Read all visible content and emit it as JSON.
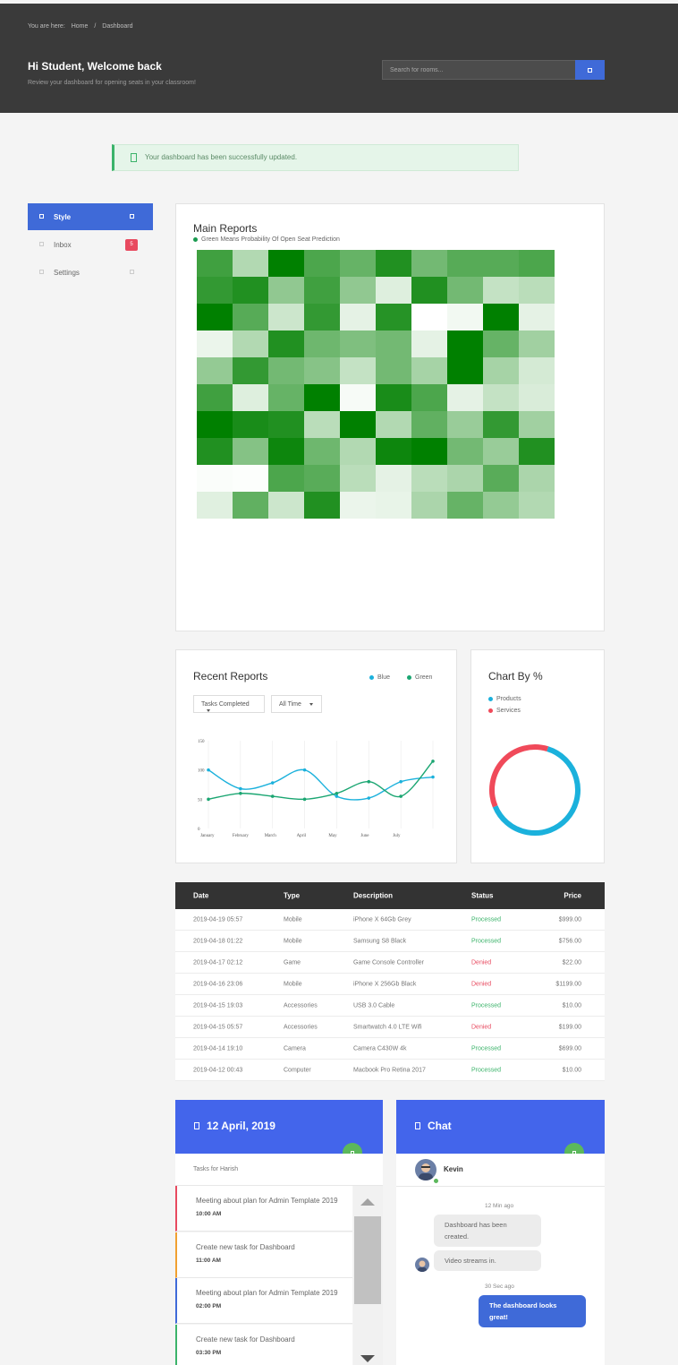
{
  "breadcrumb": {
    "prefix": "You are here:",
    "home": "Home",
    "sep": "/",
    "current": "Dashboard"
  },
  "header": {
    "welcome": "Hi Student, Welcome back",
    "subtitle": "Review your dashboard for opening seats in your classroom!"
  },
  "search": {
    "placeholder": "Search for rooms..."
  },
  "alert": {
    "text": "Your dashboard has been successfully updated."
  },
  "sidebar": {
    "items": [
      {
        "label": "Style",
        "active": true
      },
      {
        "label": "Inbox",
        "badge": "5"
      },
      {
        "label": "Settings"
      }
    ]
  },
  "main_reports": {
    "title": "Main Reports",
    "legend": "Green Means Probability Of Open Seat Prediction",
    "legend_color": "#008000",
    "heatmap_opacity": [
      [
        0.75,
        0.3,
        1,
        0.7,
        0.6,
        0.87,
        0.55,
        0.66,
        0.66,
        0.7
      ],
      [
        0.8,
        0.87,
        0.43,
        0.75,
        0.43,
        0.13,
        0.87,
        0.55,
        0.23,
        0.27
      ],
      [
        1,
        0.66,
        0.2,
        0.8,
        0.1,
        0.85,
        0,
        0.05,
        1,
        0.1
      ],
      [
        0.08,
        0.3,
        0.87,
        0.57,
        0.5,
        0.55,
        0.1,
        1,
        0.6,
        0.37
      ],
      [
        0.42,
        0.8,
        0.55,
        0.47,
        0.23,
        0.55,
        0.35,
        1,
        0.35,
        0.17
      ],
      [
        0.75,
        0.13,
        0.6,
        1,
        0.03,
        0.9,
        0.7,
        0.1,
        0.23,
        0.15
      ],
      [
        1,
        0.9,
        0.87,
        0.27,
        1,
        0.3,
        0.62,
        0.4,
        0.8,
        0.37
      ],
      [
        0.87,
        0.48,
        0.95,
        0.57,
        0.3,
        0.95,
        1,
        0.55,
        0.4,
        0.87
      ],
      [
        0.02,
        0.01,
        0.7,
        0.65,
        0.27,
        0.1,
        0.27,
        0.33,
        0.65,
        0.33
      ],
      [
        0.12,
        0.62,
        0.2,
        0.87,
        0.08,
        0.09,
        0.33,
        0.6,
        0.42,
        0.3
      ]
    ]
  },
  "recent_reports": {
    "title": "Recent Reports",
    "legend": [
      {
        "name": "Blue",
        "color": "#1bb1dc"
      },
      {
        "name": "Green",
        "color": "#1ba672"
      }
    ],
    "filter1": "Tasks Completed",
    "filter2": "All Time"
  },
  "chart_data": [
    {
      "type": "line",
      "title": "Recent Reports",
      "categories": [
        "January",
        "February",
        "March",
        "April",
        "May",
        "June",
        "July",
        ""
      ],
      "y_ticks": [
        "150",
        "100",
        "50",
        "0"
      ],
      "ylim": [
        0,
        150
      ],
      "series": [
        {
          "name": "Blue",
          "color": "#1bb1dc",
          "values": [
            100,
            68,
            78,
            100,
            55,
            52,
            80,
            88
          ]
        },
        {
          "name": "Green",
          "color": "#1ba672",
          "values": [
            50,
            60,
            55,
            50,
            60,
            80,
            55,
            115
          ]
        }
      ]
    },
    {
      "type": "pie",
      "title": "Chart By %",
      "categories": [
        "Products",
        "Services"
      ],
      "values": [
        64,
        36
      ],
      "colors": [
        "#1bb1dc",
        "#f04a5a"
      ]
    }
  ],
  "chart_pct": {
    "title": "Chart By %",
    "legend": [
      {
        "name": "Products",
        "color": "#1bb1dc"
      },
      {
        "name": "Services",
        "color": "#f04a5a"
      }
    ]
  },
  "table": {
    "headers": [
      "Date",
      "Type",
      "Description",
      "Status",
      "Price"
    ],
    "rows": [
      [
        "2019-04-19 05:57",
        "Mobile",
        "iPhone X 64Gb Grey",
        "Processed",
        "$999.00"
      ],
      [
        "2019-04-18 01:22",
        "Mobile",
        "Samsung S8 Black",
        "Processed",
        "$756.00"
      ],
      [
        "2019-04-17 02:12",
        "Game",
        "Game Console Controller",
        "Denied",
        "$22.00"
      ],
      [
        "2019-04-16 23:06",
        "Mobile",
        "iPhone X 256Gb Black",
        "Denied",
        "$1199.00"
      ],
      [
        "2019-04-15 19:03",
        "Accessories",
        "USB 3.0 Cable",
        "Processed",
        "$10.00"
      ],
      [
        "2019-04-15 05:57",
        "Accessories",
        "Smartwatch 4.0 LTE Wifi",
        "Denied",
        "$199.00"
      ],
      [
        "2019-04-14 19:10",
        "Camera",
        "Camera C430W 4k",
        "Processed",
        "$699.00"
      ],
      [
        "2019-04-12 00:43",
        "Computer",
        "Macbook Pro Retina 2017",
        "Processed",
        "$10.00"
      ]
    ]
  },
  "tasks_panel": {
    "date": "12 April, 2019",
    "subtitle": "Tasks for Harish",
    "tasks": [
      {
        "title": "Meeting about plan for Admin Template 2019",
        "time": "10:00 AM",
        "color": "#e84a5f"
      },
      {
        "title": "Create new task for Dashboard",
        "time": "11:00 AM",
        "color": "#f0a030"
      },
      {
        "title": "Meeting about plan for Admin Template 2019",
        "time": "02:00 PM",
        "color": "#3f6ad8"
      },
      {
        "title": "Create new task for Dashboard",
        "time": "03:30 PM",
        "color": "#3bb36a"
      }
    ]
  },
  "chat_panel": {
    "title": "Chat",
    "user": "Kevin",
    "time1": "12 Min ago",
    "msg1": "Dashboard has been created.",
    "msg2": "Video streams in.",
    "time2": "30 Sec ago",
    "msg3": "The dashboard looks great!"
  }
}
